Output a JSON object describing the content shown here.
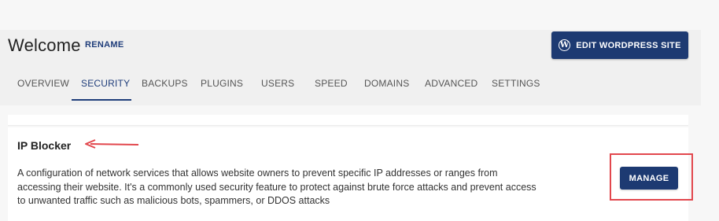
{
  "header": {
    "title": "Welcome",
    "rename_label": "RENAME",
    "edit_button_label": "EDIT WORDPRESS SITE",
    "edit_button_icon": "wordpress-icon"
  },
  "tabs": [
    {
      "label": "OVERVIEW",
      "active": false
    },
    {
      "label": "SECURITY",
      "active": true
    },
    {
      "label": "BACKUPS",
      "active": false
    },
    {
      "label": "PLUGINS",
      "active": false
    },
    {
      "label": "USERS",
      "active": false
    },
    {
      "label": "SPEED",
      "active": false
    },
    {
      "label": "DOMAINS",
      "active": false
    },
    {
      "label": "ADVANCED",
      "active": false
    },
    {
      "label": "SETTINGS",
      "active": false
    }
  ],
  "card": {
    "title": "IP Blocker",
    "description": "A configuration of network services that allows website owners to prevent specific IP addresses or ranges from accessing their website. It's a commonly used security feature to protect against brute force attacks and prevent access to unwanted traffic such as malicious bots, spammers, or DDOS attacks",
    "manage_label": "MANAGE"
  },
  "colors": {
    "primary": "#1d3a72",
    "annotation": "#e2474d",
    "active_tab": "#1f3d7a"
  }
}
